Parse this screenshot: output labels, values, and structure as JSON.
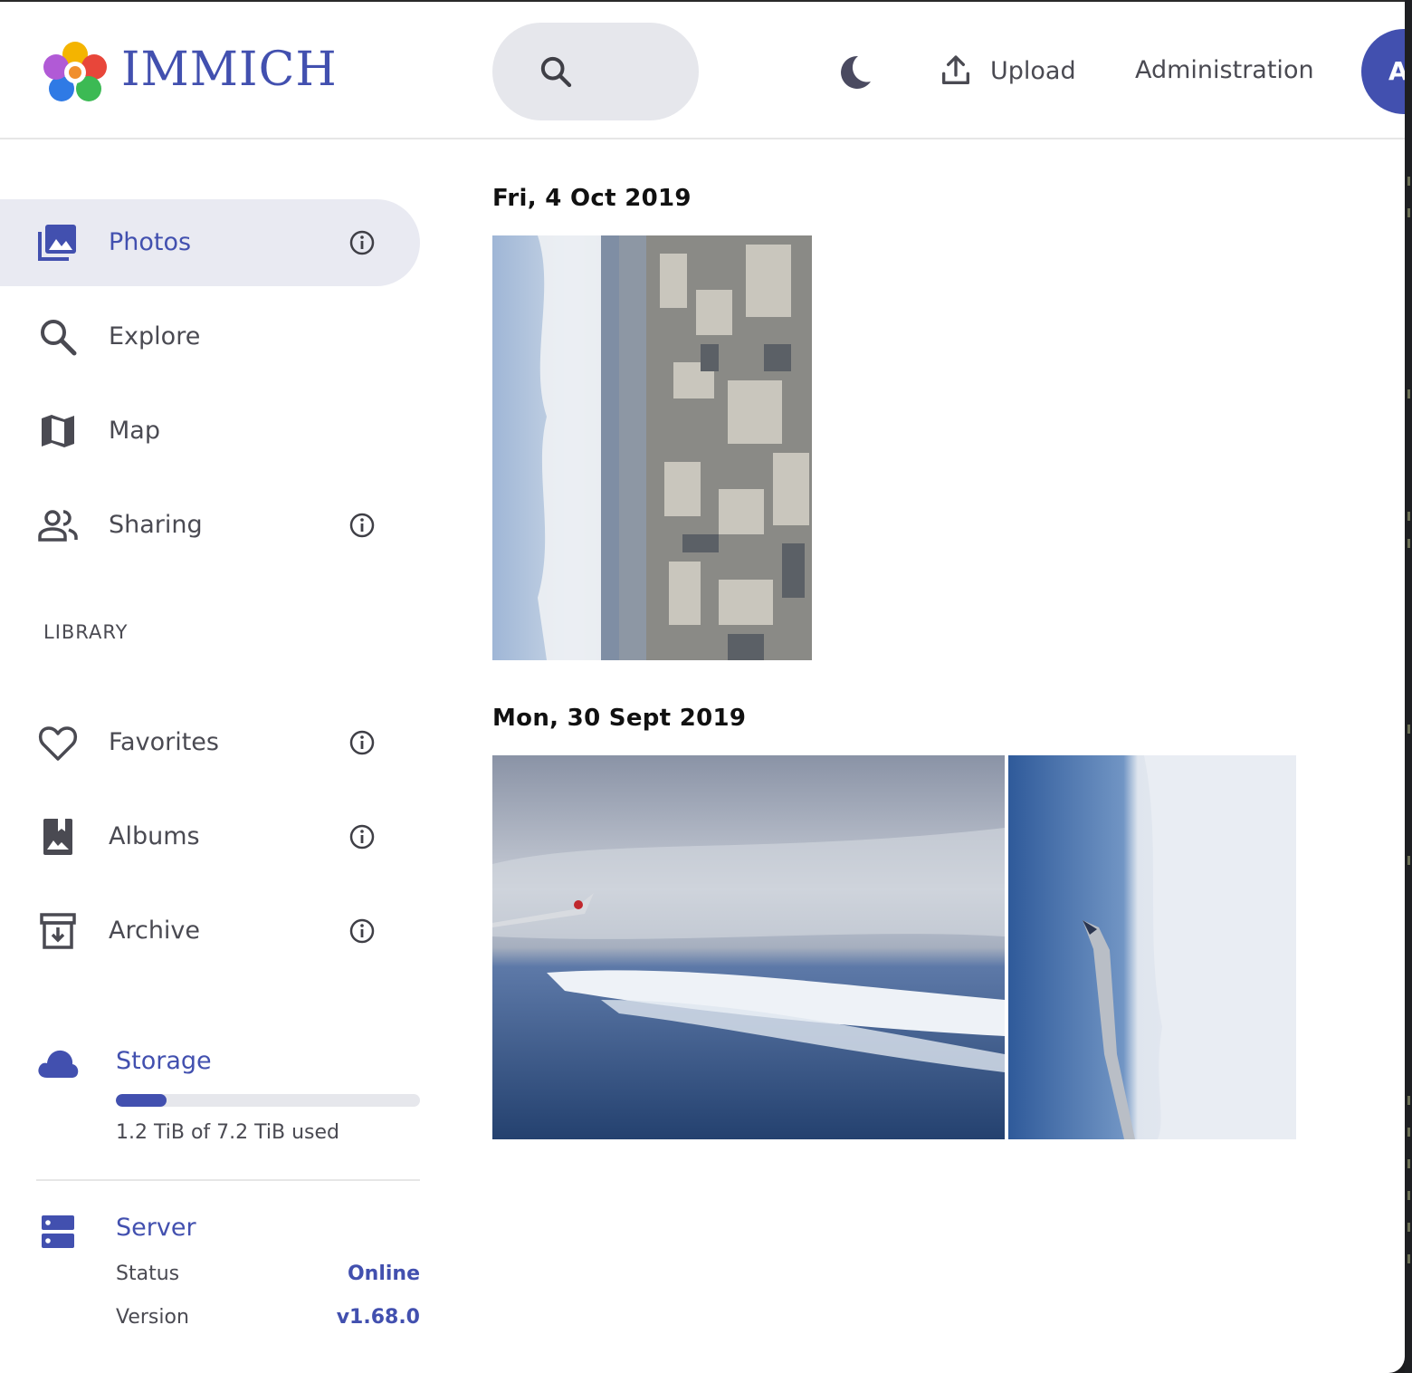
{
  "app": {
    "name": "IMMICH"
  },
  "header": {
    "upload_label": "Upload",
    "admin_label": "Administration",
    "avatar_initial": "A"
  },
  "sidebar": {
    "items": [
      {
        "label": "Photos",
        "icon": "photos-icon",
        "active": true,
        "info": true
      },
      {
        "label": "Explore",
        "icon": "search-icon",
        "active": false,
        "info": false
      },
      {
        "label": "Map",
        "icon": "map-icon",
        "active": false,
        "info": false
      },
      {
        "label": "Sharing",
        "icon": "people-icon",
        "active": false,
        "info": true
      }
    ],
    "library_heading": "LIBRARY",
    "library_items": [
      {
        "label": "Favorites",
        "icon": "heart-icon",
        "info": true
      },
      {
        "label": "Albums",
        "icon": "album-icon",
        "info": true
      },
      {
        "label": "Archive",
        "icon": "archive-icon",
        "info": true
      }
    ],
    "storage": {
      "title": "Storage",
      "usage_text": "1.2 TiB of 7.2 TiB used",
      "used_fraction": 0.167
    },
    "server": {
      "title": "Server",
      "status_label": "Status",
      "status_value": "Online",
      "version_label": "Version",
      "version_value": "v1.68.0"
    }
  },
  "timeline": {
    "groups": [
      {
        "date": "Fri, 4 Oct 2019",
        "photos": [
          "city-aerial-photo"
        ]
      },
      {
        "date": "Mon, 30 Sept 2019",
        "photos": [
          "wing-over-clouds-photo",
          "wing-vertical-photo"
        ]
      }
    ]
  },
  "colors": {
    "accent": "#4250af",
    "active_nav_bg": "#e9eaf2",
    "search_bg": "#e6e7ec",
    "text_muted": "#4a4a52"
  }
}
